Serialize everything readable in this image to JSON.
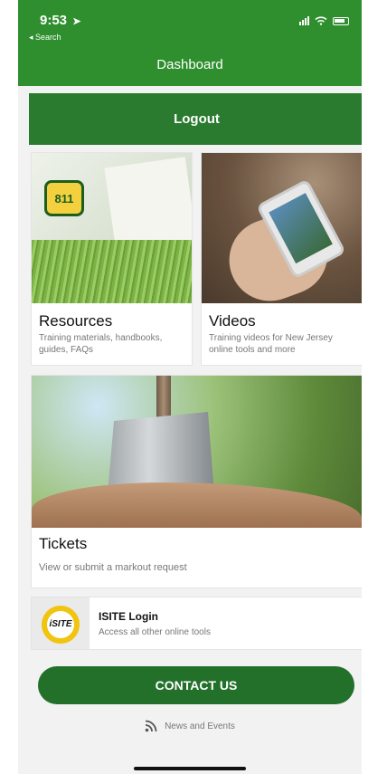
{
  "status_bar": {
    "time": "9:53",
    "location_arrow": "➤",
    "back_label": "◂ Search"
  },
  "header": {
    "title": "Dashboard"
  },
  "logout": {
    "label": "Logout"
  },
  "cards": {
    "resources": {
      "title": "Resources",
      "description": "Training materials, handbooks, guides, FAQs",
      "image_badge": "811"
    },
    "videos": {
      "title": "Videos",
      "description": "Training videos for New Jersey online tools and more"
    },
    "tickets": {
      "title": "Tickets",
      "description": "View or submit a markout request"
    },
    "isite": {
      "logo_text": "iSITE",
      "title": "ISITE Login",
      "description": "Access all other online tools"
    }
  },
  "contact": {
    "label": "CONTACT US"
  },
  "news": {
    "label": "News and Events",
    "icon": "rss-icon"
  },
  "colors": {
    "brand_green": "#2f8f2f",
    "button_green": "#2a7a2f",
    "accent_yellow": "#f1c40f"
  }
}
